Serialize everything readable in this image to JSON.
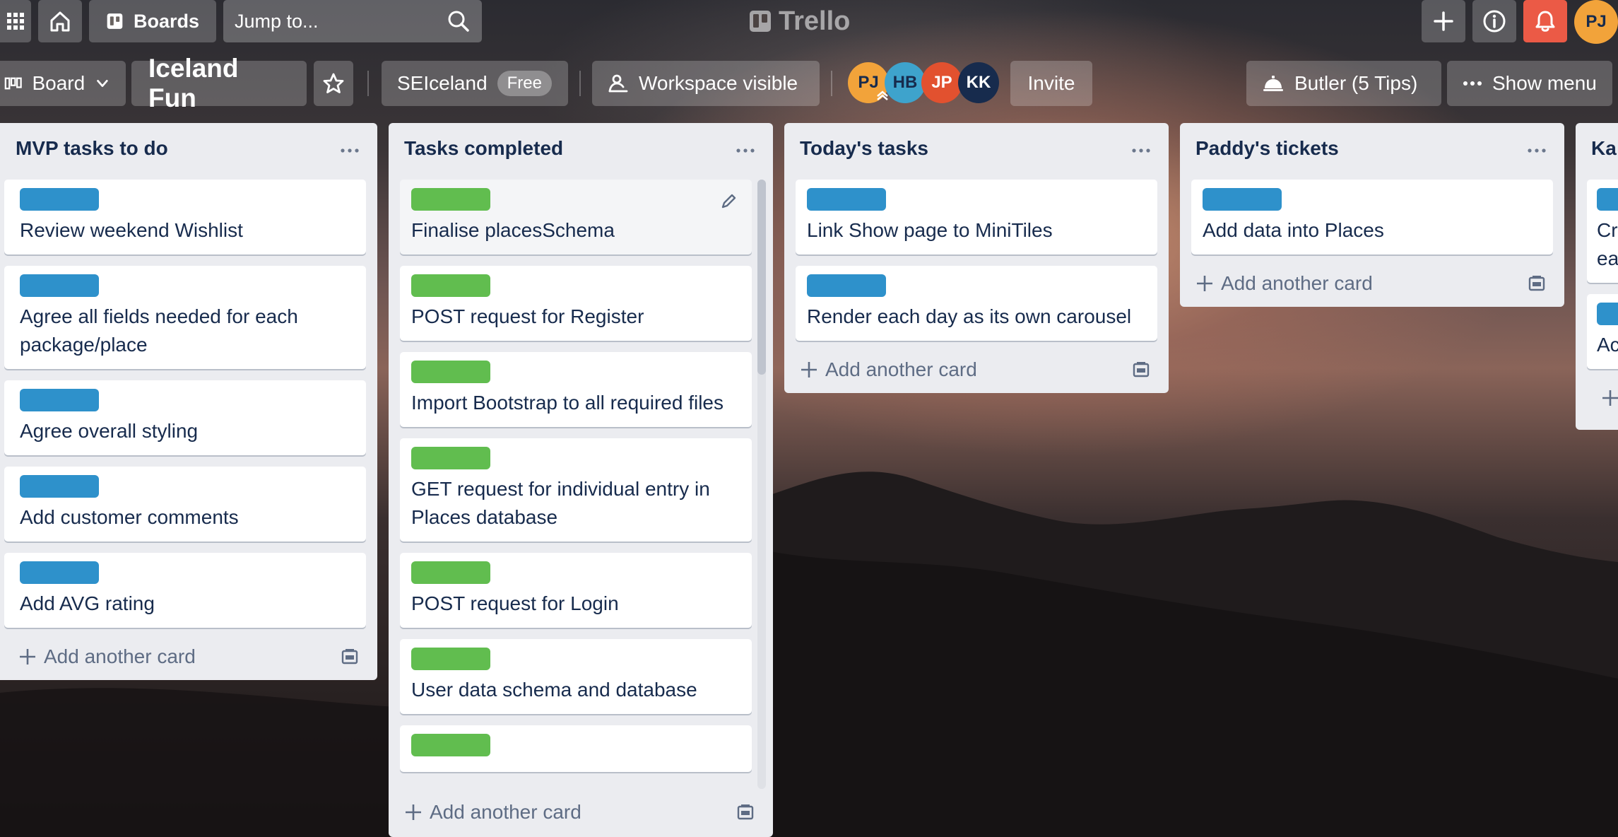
{
  "topbar": {
    "boards_label": "Boards",
    "search_placeholder": "Jump to...",
    "logo_text": "Trello",
    "user_initials": "PJ"
  },
  "board_header": {
    "view_label": "Board",
    "board_name": "Iceland Fun",
    "workspace_name": "SEIceland",
    "workspace_badge": "Free",
    "visibility_label": "Workspace visible",
    "members": [
      {
        "initials": "PJ",
        "color": "#f2a33a"
      },
      {
        "initials": "HB",
        "color": "#3ea3cc"
      },
      {
        "initials": "JP",
        "color": "#e2512f"
      },
      {
        "initials": "KK",
        "color": "#172b4d"
      }
    ],
    "invite_label": "Invite",
    "butler_label": "Butler (5 Tips)",
    "show_menu_label": "Show menu"
  },
  "lists": [
    {
      "title": "MVP tasks to do",
      "cards": [
        {
          "label_color": "blue",
          "title": "Review weekend Wishlist"
        },
        {
          "label_color": "blue",
          "title": "Agree all fields needed for each package/place"
        },
        {
          "label_color": "blue",
          "title": "Agree overall styling"
        },
        {
          "label_color": "blue",
          "title": "Add customer comments"
        },
        {
          "label_color": "blue",
          "title": "Add AVG rating"
        }
      ],
      "add_card_label": "Add another card"
    },
    {
      "title": "Tasks completed",
      "cards": [
        {
          "label_color": "green",
          "title": "Finalise placesSchema"
        },
        {
          "label_color": "green",
          "title": "POST request for Register"
        },
        {
          "label_color": "green",
          "title": "Import Bootstrap to all required files"
        },
        {
          "label_color": "green",
          "title": "GET request for individual entry in Places database"
        },
        {
          "label_color": "green",
          "title": "POST request for Login"
        },
        {
          "label_color": "green",
          "title": "User data schema and database"
        },
        {
          "label_color": "green",
          "title": ""
        }
      ],
      "add_card_label": "Add another card"
    },
    {
      "title": "Today's tasks",
      "cards": [
        {
          "label_color": "blue",
          "title": "Link Show page to MiniTiles"
        },
        {
          "label_color": "blue",
          "title": "Render each day as its own carousel"
        }
      ],
      "add_card_label": "Add another card"
    },
    {
      "title": "Paddy's tickets",
      "cards": [
        {
          "label_color": "blue",
          "title": "Add data into Places"
        }
      ],
      "add_card_label": "Add another card"
    },
    {
      "title": "Ka",
      "cards": [
        {
          "label_color": "blue",
          "title": "Cr ea"
        },
        {
          "label_color": "blue",
          "title": "Ac"
        }
      ],
      "add_card_label": ""
    }
  ]
}
